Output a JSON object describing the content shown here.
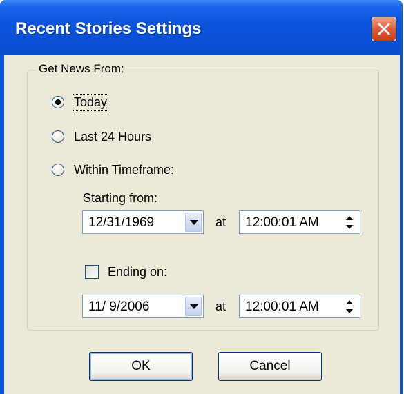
{
  "window": {
    "title": "Recent Stories Settings"
  },
  "group": {
    "label": "Get News From:",
    "options": [
      {
        "label": "Today",
        "selected": true
      },
      {
        "label": "Last 24 Hours",
        "selected": false
      },
      {
        "label": "Within Timeframe:",
        "selected": false
      }
    ]
  },
  "start": {
    "label": "Starting from:",
    "date": "12/31/1969",
    "at": "at",
    "time": "12:00:01 AM"
  },
  "end": {
    "label": "Ending on:",
    "checked": false,
    "date": "11/ 9/2006",
    "at": "at",
    "time": "12:00:01 AM"
  },
  "buttons": {
    "ok": "OK",
    "cancel": "Cancel"
  }
}
